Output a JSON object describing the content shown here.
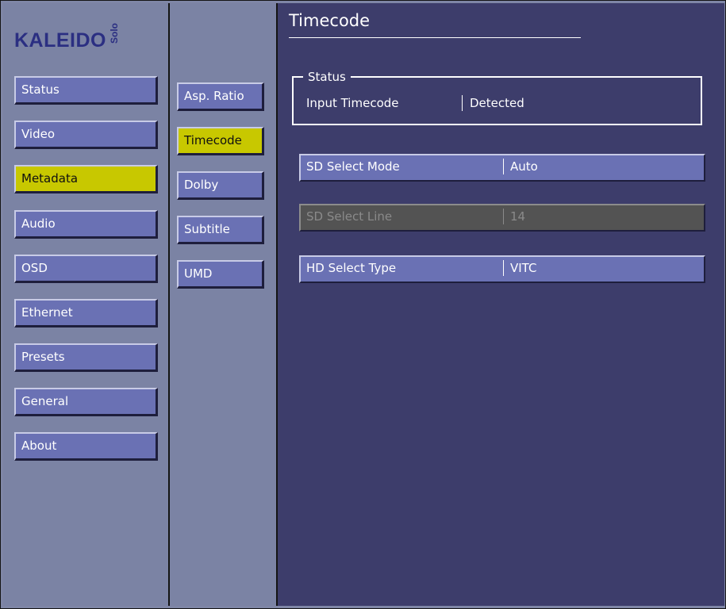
{
  "brand": {
    "name": "KALEIDO",
    "edition": "Solo"
  },
  "colors": {
    "accent": "#c8c800",
    "button": "#6a71b4",
    "panel": "#3d3d6b",
    "sidebar": "#7b83a4",
    "disabled": "#535353"
  },
  "left_nav": [
    {
      "label": "Status",
      "active": false
    },
    {
      "label": "Video",
      "active": false
    },
    {
      "label": "Metadata",
      "active": true
    },
    {
      "label": "Audio",
      "active": false
    },
    {
      "label": "OSD",
      "active": false
    },
    {
      "label": "Ethernet",
      "active": false
    },
    {
      "label": "Presets",
      "active": false
    },
    {
      "label": "General",
      "active": false
    },
    {
      "label": "About",
      "active": false
    }
  ],
  "sub_nav": [
    {
      "label": "Asp. Ratio",
      "active": false
    },
    {
      "label": "Timecode",
      "active": true
    },
    {
      "label": "Dolby",
      "active": false
    },
    {
      "label": "Subtitle",
      "active": false
    },
    {
      "label": "UMD",
      "active": false
    }
  ],
  "main": {
    "title": "Timecode",
    "status_group": {
      "legend": "Status",
      "label": "Input Timecode",
      "value": "Detected"
    },
    "fields": [
      {
        "label": "SD Select Mode",
        "value": "Auto",
        "enabled": true
      },
      {
        "label": "SD Select Line",
        "value": "14",
        "enabled": false
      },
      {
        "label": "HD Select Type",
        "value": "VITC",
        "enabled": true
      }
    ]
  }
}
